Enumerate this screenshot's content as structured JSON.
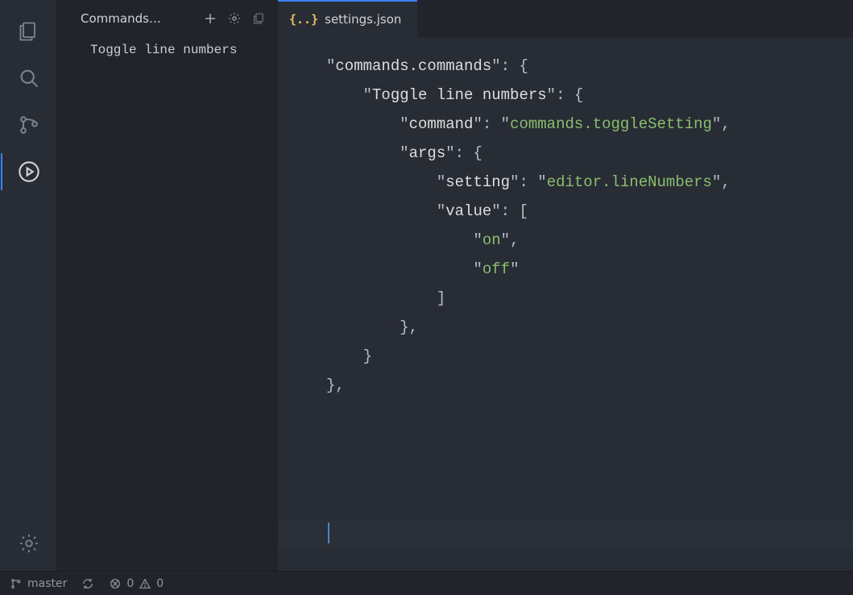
{
  "activity_bar": {
    "items": [
      "explorer",
      "search",
      "source-control",
      "run"
    ],
    "active": "run"
  },
  "side_panel": {
    "title": "Commands…",
    "items": [
      "Toggle line numbers"
    ]
  },
  "editor": {
    "tab": {
      "filename": "settings.json",
      "icon_label": "{..}"
    },
    "code_lines": [
      {
        "indent": 0,
        "key": "commands.commands",
        "after": ": {"
      },
      {
        "indent": 1,
        "key": "Toggle line numbers",
        "after": ": {"
      },
      {
        "indent": 2,
        "key": "command",
        "after": ": ",
        "str": "commands.toggleSetting",
        "tail": ","
      },
      {
        "indent": 2,
        "key": "args",
        "after": ": {"
      },
      {
        "indent": 3,
        "key": "setting",
        "after": ": ",
        "str": "editor.lineNumbers",
        "tail": ","
      },
      {
        "indent": 3,
        "key": "value",
        "after": ": ["
      },
      {
        "indent": 4,
        "str": "on",
        "tail": ","
      },
      {
        "indent": 4,
        "str": "off"
      },
      {
        "indent": 3,
        "plain": "]"
      },
      {
        "indent": 2,
        "plain": "},"
      },
      {
        "indent": 1,
        "plain": "}"
      },
      {
        "indent": 0,
        "plain": "},"
      }
    ]
  },
  "status_bar": {
    "branch": "master",
    "errors": "0",
    "warnings": "0"
  }
}
